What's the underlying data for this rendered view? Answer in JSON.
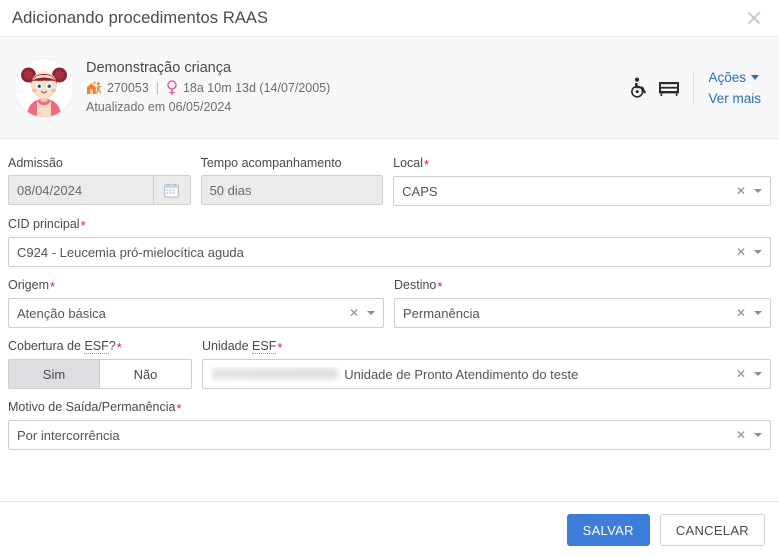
{
  "dialog": {
    "title": "Adicionando procedimentos RAAS",
    "close_icon": "close-icon"
  },
  "patient": {
    "name": "Demonstração criança",
    "record_number": "270053",
    "separator": "|",
    "age": "18a 10m 13d (14/07/2005)",
    "updated": "Atualizado em 06/05/2024",
    "home_care_icon": "home-care-icon",
    "gender_icon": "female-gender-icon",
    "status_icons": [
      {
        "name": "wheelchair-icon"
      },
      {
        "name": "bed-icon"
      }
    ],
    "actions_link": "Ações",
    "more_link": "Ver mais"
  },
  "form": {
    "admissao": {
      "label": "Admissão",
      "value": "08/04/2024",
      "calendar_icon": "calendar-icon",
      "disabled": true
    },
    "tempo": {
      "label": "Tempo acompanhamento",
      "value": "50 dias",
      "disabled": true
    },
    "local": {
      "label": "Local",
      "required": "*",
      "value": "CAPS"
    },
    "cid": {
      "label": "CID principal",
      "required": "*",
      "value": "C924 - Leucemia pró-mielocítica aguda"
    },
    "origem": {
      "label": "Origem",
      "required": "*",
      "value": "Atenção básica"
    },
    "destino": {
      "label": "Destino",
      "required": "*",
      "value": "Permanência"
    },
    "cobertura": {
      "label_prefix": "Cobertura de ",
      "label_abbr": "ESF",
      "label_suffix": "?",
      "required": "*",
      "options": [
        "Sim",
        "Não"
      ],
      "selected": "Sim"
    },
    "unidade": {
      "label_prefix": "Unidade ",
      "label_abbr": "ESF",
      "required": "*",
      "redacted_value": "XXXX  Agostinho Filho",
      "value": "Unidade de Pronto Atendimento do teste"
    },
    "motivo": {
      "label": "Motivo de Saída/Permanência",
      "required": "*",
      "value": "Por intercorrência"
    },
    "clear_icon": "clear-x-icon",
    "dropdown_icon": "chevron-down-icon"
  },
  "footer": {
    "save_label": "SALVAR",
    "cancel_label": "CANCELAR"
  },
  "colors": {
    "primary": "#3b7dd8",
    "link": "#2d6cb5",
    "required": "#e02020",
    "card_bg": "#f7f8fa",
    "home_icon": "#f07f2e",
    "gender_icon": "#e8648c"
  }
}
